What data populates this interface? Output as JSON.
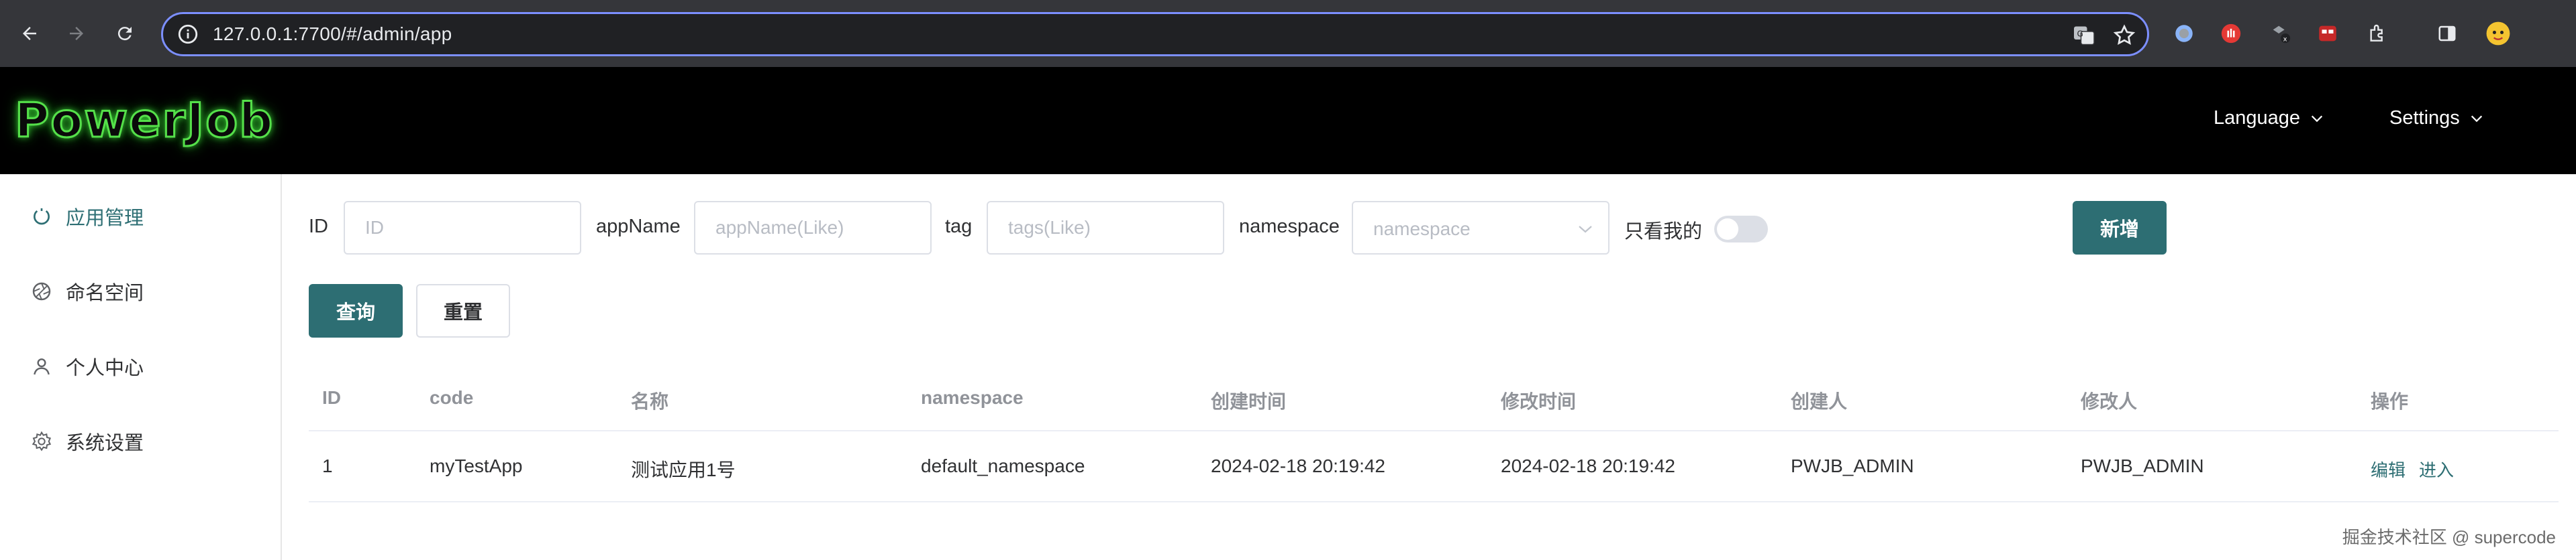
{
  "browser": {
    "url": "127.0.0.1:7700/#/admin/app",
    "icons": [
      "back-icon",
      "forward-icon",
      "reload-icon",
      "info-icon",
      "translate-icon",
      "bookmark-star-icon",
      "extension-icons",
      "sidebar-icon",
      "profile-avatar"
    ]
  },
  "header": {
    "logo": "PowerJob",
    "menus": [
      {
        "label": "Language"
      },
      {
        "label": "Settings"
      }
    ]
  },
  "sidebar": {
    "items": [
      {
        "label": "应用管理",
        "icon": "app-icon",
        "active": true
      },
      {
        "label": "命名空间",
        "icon": "aperture-icon"
      },
      {
        "label": "个人中心",
        "icon": "user-icon"
      },
      {
        "label": "系统设置",
        "icon": "gear-icon"
      }
    ]
  },
  "filters": {
    "id_label": "ID",
    "id_placeholder": "ID",
    "appname_label": "appName",
    "appname_placeholder": "appName(Like)",
    "tag_label": "tag",
    "tag_placeholder": "tags(Like)",
    "namespace_label": "namespace",
    "namespace_placeholder": "namespace",
    "only_mine_label": "只看我的",
    "only_mine": false,
    "add_button": "新增",
    "query_button": "查询",
    "reset_button": "重置"
  },
  "table": {
    "columns": [
      "ID",
      "code",
      "名称",
      "namespace",
      "创建时间",
      "修改时间",
      "创建人",
      "修改人",
      "操作"
    ],
    "rows": [
      {
        "id": "1",
        "code": "myTestApp",
        "name": "测试应用1号",
        "namespace": "default_namespace",
        "created": "2024-02-18 20:19:42",
        "modified": "2024-02-18 20:19:42",
        "creator": "PWJB_ADMIN",
        "modifier": "PWJB_ADMIN",
        "actions": [
          "编辑",
          "进入"
        ]
      }
    ]
  },
  "watermark": "掘金技术社区 @ supercode",
  "colors": {
    "primary": "#2d6e73",
    "header_bg": "#000000",
    "logo_glow": "#55e04a",
    "chrome_bg": "#35363a"
  }
}
